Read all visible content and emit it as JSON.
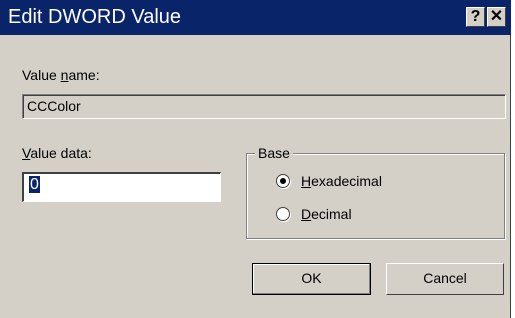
{
  "window": {
    "title": "Edit DWORD Value",
    "help_button": "?",
    "close_button": "✕"
  },
  "value_name": {
    "label_pre": "Value ",
    "label_accel": "n",
    "label_post": "ame:",
    "value": "CCColor"
  },
  "value_data": {
    "label_accel": "V",
    "label_post": "alue data:",
    "value": "0"
  },
  "base": {
    "legend": "Base",
    "options": [
      {
        "accel": "H",
        "rest": "exadecimal",
        "checked": true
      },
      {
        "accel": "D",
        "rest": "ecimal",
        "checked": false
      }
    ]
  },
  "buttons": {
    "ok": "OK",
    "cancel": "Cancel"
  },
  "colors": {
    "titlebar": "#0a246a",
    "dialog_face": "#d4d0c8"
  }
}
